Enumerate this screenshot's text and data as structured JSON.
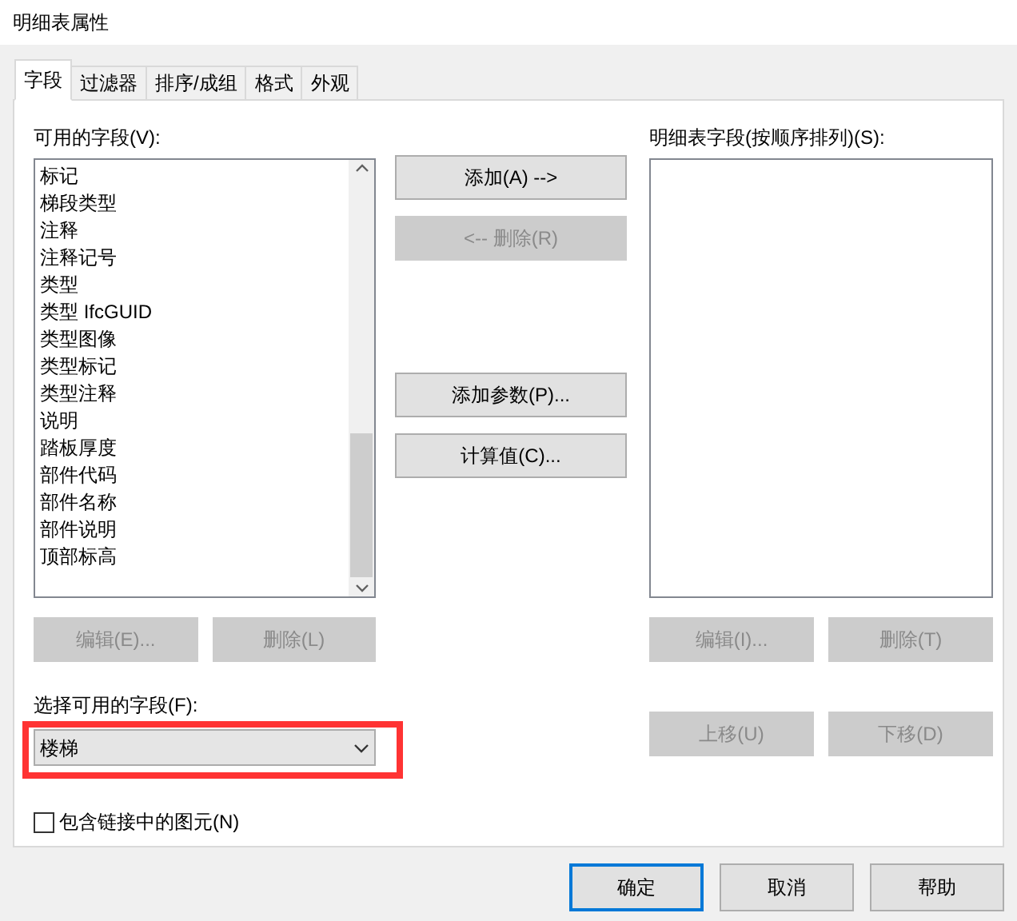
{
  "window": {
    "title": "明细表属性"
  },
  "tabs": [
    {
      "label": "字段",
      "selected": true
    },
    {
      "label": "过滤器",
      "selected": false
    },
    {
      "label": "排序/成组",
      "selected": false
    },
    {
      "label": "格式",
      "selected": false
    },
    {
      "label": "外观",
      "selected": false
    }
  ],
  "available_fields": {
    "label": "可用的字段(V):",
    "items": [
      "标记",
      "梯段类型",
      "注释",
      "注释记号",
      "类型",
      "类型 IfcGUID",
      "类型图像",
      "类型标记",
      "类型注释",
      "说明",
      "踏板厚度",
      "部件代码",
      "部件名称",
      "部件说明",
      "顶部标高"
    ],
    "buttons": [
      {
        "label": "编辑(E)...",
        "disabled": true
      },
      {
        "label": "删除(L)",
        "disabled": true
      }
    ]
  },
  "middle_buttons": [
    {
      "label": "添加(A) -->",
      "disabled": false
    },
    {
      "label": "<-- 删除(R)",
      "disabled": true
    },
    {
      "label": "添加参数(P)...",
      "disabled": false
    },
    {
      "label": "计算值(C)...",
      "disabled": false
    }
  ],
  "schedule_fields": {
    "label": "明细表字段(按顺序排列)(S):",
    "buttons": [
      {
        "label": "编辑(I)...",
        "disabled": true
      },
      {
        "label": "删除(T)",
        "disabled": true
      }
    ],
    "move_buttons": [
      {
        "label": "上移(U)",
        "disabled": true
      },
      {
        "label": "下移(D)",
        "disabled": true
      }
    ]
  },
  "select_fields": {
    "label": "选择可用的字段(F):",
    "value": "楼梯",
    "highlighted": true
  },
  "include_linked": {
    "label": "包含链接中的图元(N)",
    "checked": false
  },
  "footer_buttons": [
    {
      "label": "确定",
      "primary": true
    },
    {
      "label": "取消",
      "primary": false
    },
    {
      "label": "帮助",
      "primary": false
    }
  ]
}
